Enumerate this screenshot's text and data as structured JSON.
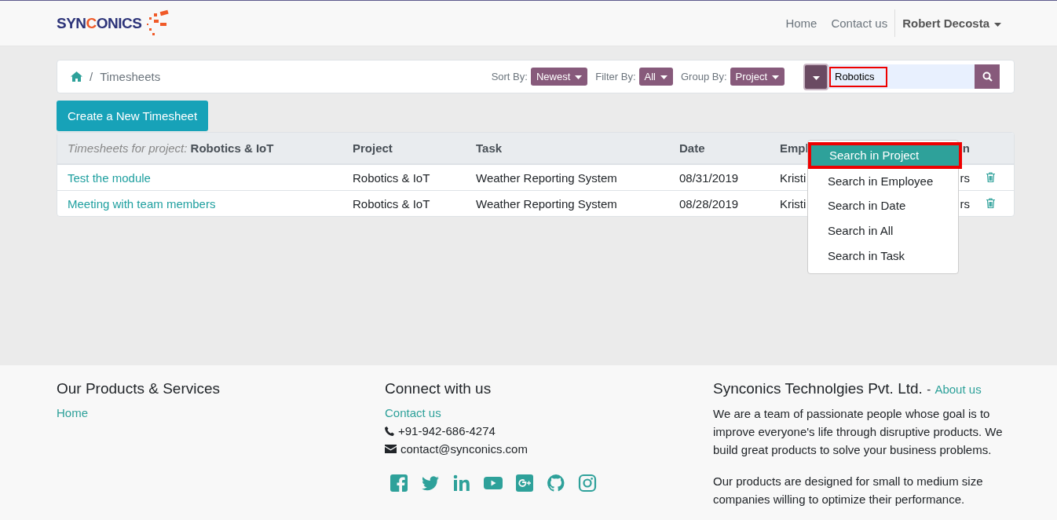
{
  "navbar": {
    "logo": {
      "parts": [
        {
          "text": "SYN",
          "accent": false
        },
        {
          "text": "C",
          "accent": true
        },
        {
          "text": "ONICS",
          "accent": false
        }
      ]
    },
    "links": [
      "Home",
      "Contact us"
    ],
    "user": "Robert Decosta"
  },
  "breadcrumb": {
    "separator": "/",
    "items": [
      "Timesheets"
    ]
  },
  "controls": [
    {
      "label": "Sort By:",
      "value": "Newest"
    },
    {
      "label": "Filter By:",
      "value": "All"
    },
    {
      "label": "Group By:",
      "value": "Project"
    }
  ],
  "search": {
    "value": "Robotics",
    "highlighted": true,
    "options": [
      {
        "label": "Search in Project",
        "selected": true,
        "highlighted": true
      },
      {
        "label": "Search in Employee",
        "selected": false,
        "highlighted": false
      },
      {
        "label": "Search in Date",
        "selected": false,
        "highlighted": false
      },
      {
        "label": "Search in All",
        "selected": false,
        "highlighted": false
      },
      {
        "label": "Search in Task",
        "selected": false,
        "highlighted": false
      }
    ]
  },
  "create_button": "Create a New Timesheet",
  "table": {
    "group_label": "Timesheets for project:",
    "group_value": "Robotics & IoT",
    "columns": [
      "Project",
      "Task",
      "Date",
      "Empl",
      "n"
    ],
    "rows": [
      {
        "name": "Test the module",
        "cells": [
          "Robotics & IoT",
          "Weather Reporting System",
          "08/31/2019",
          "Kristi",
          "rs"
        ]
      },
      {
        "name": "Meeting with team members",
        "cells": [
          "Robotics & IoT",
          "Weather Reporting System",
          "08/28/2019",
          "Kristi",
          "rs"
        ]
      }
    ]
  },
  "footer": {
    "products": {
      "title": "Our Products & Services",
      "links": [
        "Home"
      ]
    },
    "connect": {
      "title": "Connect with us",
      "link": "Contact us",
      "phone": "+91-942-686-4274",
      "email": "contact@synconics.com"
    },
    "about": {
      "title": "Synconics Technolgies Pvt. Ltd.",
      "separator": "-",
      "link": "About us",
      "paragraphs": [
        "We are a team of passionate people whose goal is to improve everyone's life through disruptive products. We build great products to solve your business problems.",
        "Our products are designed for small to medium size companies willing to optimize their performance."
      ]
    }
  }
}
